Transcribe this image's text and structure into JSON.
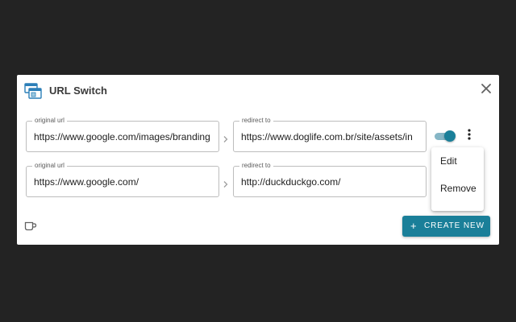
{
  "app": {
    "title": "URL Switch",
    "icon": "browser-windows-icon",
    "close_icon": "close-icon"
  },
  "rules": [
    {
      "original_legend": "original url",
      "original_value": "https://www.google.com/images/branding",
      "redirect_legend": "redirect to",
      "redirect_value": "https://www.doglife.com.br/site/assets/in",
      "enabled": true
    },
    {
      "original_legend": "original url",
      "original_value": "https://www.google.com/",
      "redirect_legend": "redirect to",
      "redirect_value": "http://duckduckgo.com/"
    }
  ],
  "menu": {
    "items": [
      {
        "label": "Edit"
      },
      {
        "label": "Remove"
      }
    ]
  },
  "footer": {
    "cup_icon": "coffee-cup-icon",
    "create_plus": "+",
    "create_label": "CREATE NEW"
  },
  "colors": {
    "background": "#232323",
    "accent": "#1a7f99",
    "toggle_track": "#86b6c6",
    "panel": "#ffffff"
  }
}
